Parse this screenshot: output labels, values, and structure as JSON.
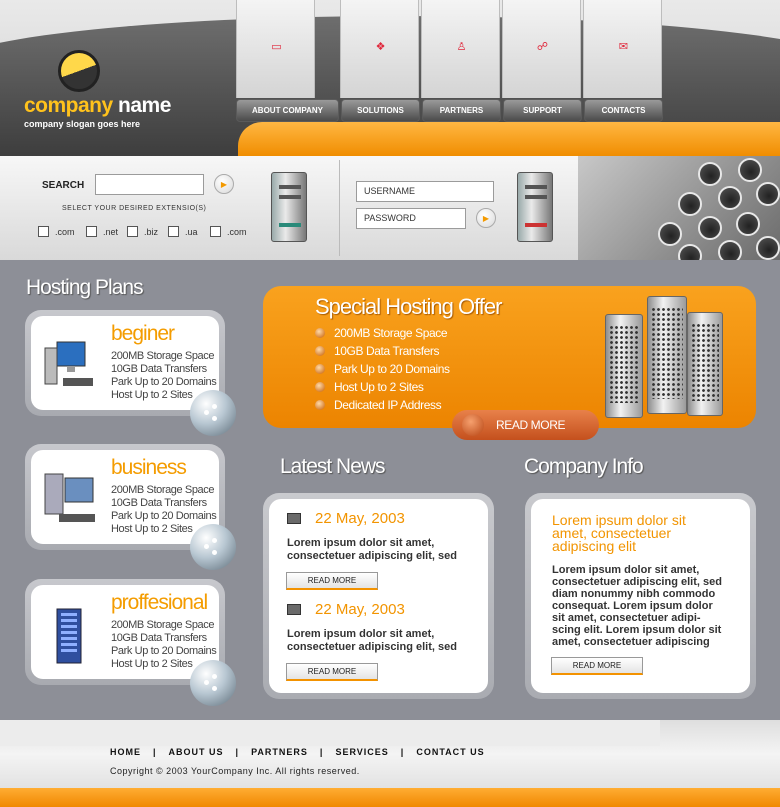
{
  "brand": {
    "name_part1": "company",
    "name_part2": "name",
    "slogan": "company slogan goes here"
  },
  "nav": [
    {
      "label": "ABOUT COMPANY",
      "icon": "card-icon",
      "glyph": "▭"
    },
    {
      "label": "SOLUTIONS",
      "icon": "diamonds-icon",
      "glyph": "❖"
    },
    {
      "label": "PARTNERS",
      "icon": "person-icon",
      "glyph": "♙"
    },
    {
      "label": "SUPPORT",
      "icon": "network-icon",
      "glyph": "☍"
    },
    {
      "label": "CONTACTS",
      "icon": "mail-icon",
      "glyph": "✉"
    }
  ],
  "search": {
    "label": "SEARCH",
    "value": "",
    "extensions_caption": "SELECT YOUR DESIRED EXTENSIO(S)",
    "extensions": [
      ".com",
      ".net",
      ".biz",
      ".ua",
      ".com"
    ]
  },
  "login": {
    "username_placeholder": "USERNAME",
    "password_placeholder": "PASSWORD"
  },
  "hosting_plans": {
    "title": "Hosting Plans",
    "plans": [
      {
        "name": "beginer",
        "features": [
          "200MB Storage Space",
          "10GB Data Transfers",
          "Park Up to 20 Domains",
          "Host Up to 2 Sites"
        ]
      },
      {
        "name": "business",
        "features": [
          "200MB Storage Space",
          "10GB Data Transfers",
          "Park Up to 20 Domains",
          "Host Up to 2 Sites"
        ]
      },
      {
        "name": "proffesional",
        "features": [
          "200MB Storage Space",
          "10GB Data Transfers",
          "Park Up to 20 Domains",
          "Host Up to 2 Sites"
        ]
      }
    ]
  },
  "offer": {
    "title": "Special Hosting Offer",
    "items": [
      "200MB Storage Space",
      "10GB Data Transfers",
      "Park Up to 20 Domains",
      "Host Up to 2 Sites",
      "Dedicated IP Address"
    ],
    "read_more": "READ MORE"
  },
  "news": {
    "title": "Latest News",
    "items": [
      {
        "date": "22 May, 2003",
        "text_line1": "Lorem ipsum dolor sit amet,",
        "text_line2": "consectetuer adipiscing elit, sed",
        "read_more": "READ MORE"
      },
      {
        "date": "22 May, 2003",
        "text_line1": "Lorem ipsum dolor sit amet,",
        "text_line2": "consectetuer adipiscing elit, sed",
        "read_more": "READ MORE"
      }
    ]
  },
  "company_info": {
    "title": "Company Info",
    "headline_lines": [
      "Lorem ipsum dolor sit",
      "amet, consectetuer",
      "adipiscing elit"
    ],
    "body_lines": [
      "Lorem ipsum dolor sit amet,",
      "consectetuer adipiscing elit, sed",
      "diam nonummy nibh commodo",
      "consequat. Lorem ipsum dolor",
      "sit amet, consectetuer adipi-",
      "scing elit. Lorem ipsum dolor sit",
      "amet, consectetuer adipiscing"
    ],
    "read_more": "READ MORE"
  },
  "footer": {
    "links": [
      "HOME",
      "ABOUT US",
      "PARTNERS",
      "SERVICES",
      "CONTACT US"
    ],
    "separator": "|",
    "copyright": "Copyright © 2003 YourCompany Inc. All rights reserved."
  },
  "colors": {
    "accent": "#f39200",
    "dark": "#3c3c3c",
    "background": "#8d8f97"
  }
}
